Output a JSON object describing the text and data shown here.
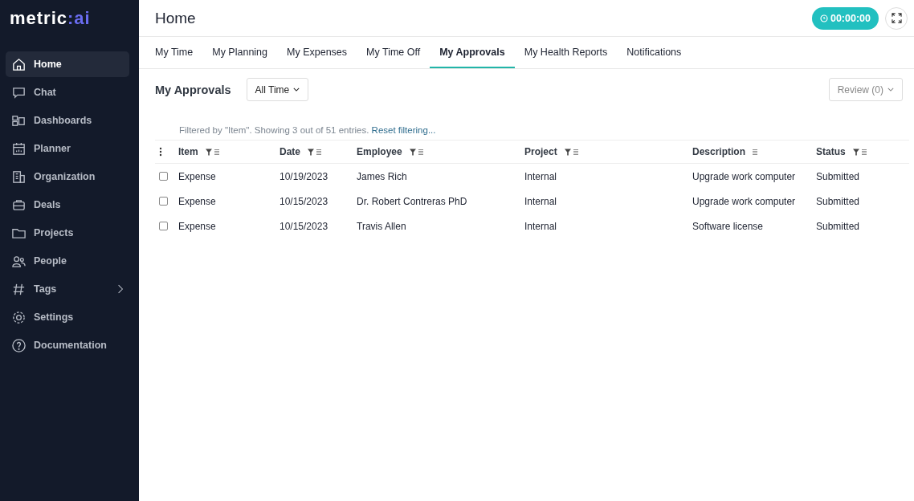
{
  "logo": {
    "name": "metric",
    "suffix": ":ai"
  },
  "sidebar": {
    "items": [
      {
        "label": "Home",
        "kind": "home",
        "selected": true,
        "expandable": false
      },
      {
        "label": "Chat",
        "kind": "chat",
        "selected": false,
        "expandable": false
      },
      {
        "label": "Dashboards",
        "kind": "dashboards",
        "selected": false,
        "expandable": false
      },
      {
        "label": "Planner",
        "kind": "planner",
        "selected": false,
        "expandable": false
      },
      {
        "label": "Organization",
        "kind": "organization",
        "selected": false,
        "expandable": false
      },
      {
        "label": "Deals",
        "kind": "deals",
        "selected": false,
        "expandable": false
      },
      {
        "label": "Projects",
        "kind": "projects",
        "selected": false,
        "expandable": false
      },
      {
        "label": "People",
        "kind": "people",
        "selected": false,
        "expandable": false
      },
      {
        "label": "Tags",
        "kind": "tags",
        "selected": false,
        "expandable": true
      },
      {
        "label": "Settings",
        "kind": "settings",
        "selected": false,
        "expandable": false
      },
      {
        "label": "Documentation",
        "kind": "documentation",
        "selected": false,
        "expandable": false
      }
    ]
  },
  "header": {
    "title": "Home",
    "timer": "00:00:00"
  },
  "tabs": [
    {
      "label": "My Time",
      "selected": false
    },
    {
      "label": "My Planning",
      "selected": false
    },
    {
      "label": "My Expenses",
      "selected": false
    },
    {
      "label": "My Time Off",
      "selected": false
    },
    {
      "label": "My Approvals",
      "selected": true
    },
    {
      "label": "My Health Reports",
      "selected": false
    },
    {
      "label": "Notifications",
      "selected": false
    }
  ],
  "toolbar": {
    "title": "My Approvals",
    "period": "All Time",
    "review": "Review (0)"
  },
  "filter_note": {
    "text": "Filtered by \"Item\". Showing 3 out of 51 entries.",
    "link": "Reset filtering..."
  },
  "table": {
    "columns": [
      {
        "label": "Item",
        "filter": true
      },
      {
        "label": "Date",
        "filter": true
      },
      {
        "label": "Employee",
        "filter": true
      },
      {
        "label": "Project",
        "filter": true
      },
      {
        "label": "Description",
        "filter": false
      },
      {
        "label": "Status",
        "filter": true
      }
    ],
    "rows": [
      {
        "checked": false,
        "cells": [
          "Expense",
          "10/19/2023",
          "James Rich",
          "Internal",
          "Upgrade work computer",
          "Submitted"
        ]
      },
      {
        "checked": false,
        "cells": [
          "Expense",
          "10/15/2023",
          "Dr. Robert Contreras PhD",
          "Internal",
          "Upgrade work computer",
          "Submitted"
        ]
      },
      {
        "checked": false,
        "cells": [
          "Expense",
          "10/15/2023",
          "Travis Allen",
          "Internal",
          "Software license",
          "Submitted"
        ]
      }
    ]
  }
}
